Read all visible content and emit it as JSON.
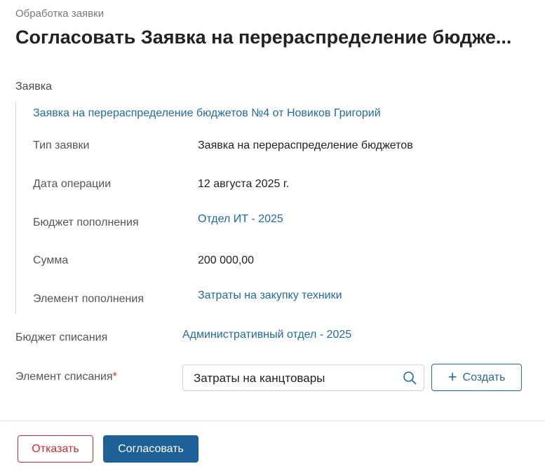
{
  "header": {
    "breadcrumb": "Обработка заявки",
    "title": "Согласовать Заявка на перераспределение бюдже..."
  },
  "request_section": {
    "label": "Заявка",
    "link": "Заявка на перераспределение бюджетов №4 от Новиков Григорий",
    "rows": [
      {
        "label": "Тип заявки",
        "value": "Заявка на перераспределение бюджетов"
      },
      {
        "label": "Дата операции",
        "value": "12 августа 2025 г."
      },
      {
        "label": "Бюджет пополнения",
        "value": "Отдел ИТ - 2025"
      },
      {
        "label": "Сумма",
        "value": "200 000,00"
      },
      {
        "label": "Элемент пополнения",
        "value": "Затраты на закупку техники"
      }
    ]
  },
  "writeoff": {
    "budget_label": "Бюджет списания",
    "budget_value": "Административный отдел - 2025",
    "element_label": "Элемент списания",
    "required_mark": "*",
    "element_value": "Затраты на канцтовары",
    "create_label": "Создать",
    "create_icon": "plus-icon",
    "search_icon": "search-icon"
  },
  "actions": {
    "reject_label": "Отказать",
    "approve_label": "Согласовать"
  },
  "colors": {
    "link": "#1f6aa5",
    "primary": "#1e6098",
    "danger": "#d12b2b"
  }
}
